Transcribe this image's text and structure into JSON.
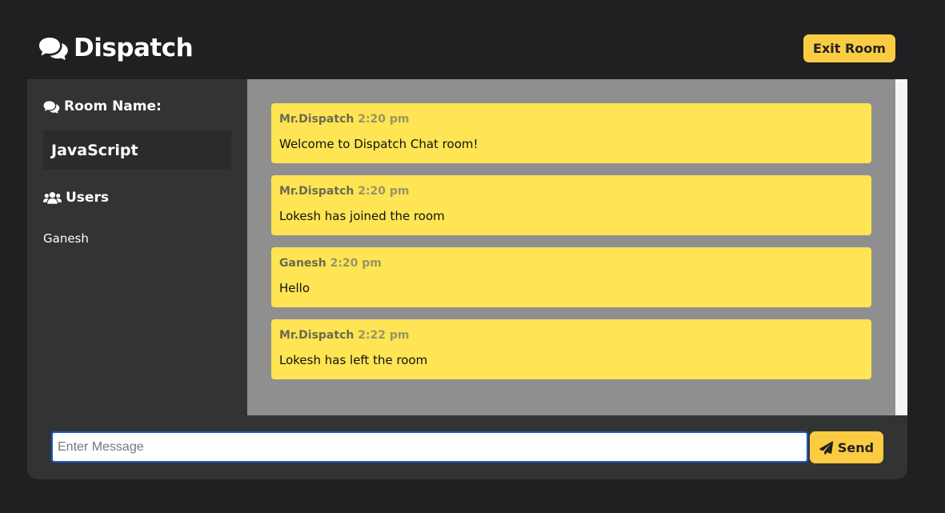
{
  "header": {
    "logo_icon": "comments-icon",
    "app_title": "Dispatch",
    "exit_label": "Exit Room"
  },
  "sidebar": {
    "room_heading": "Room Name:",
    "room_name": "JavaScript",
    "users_heading": "Users",
    "users": [
      "Ganesh"
    ]
  },
  "messages": [
    {
      "user": "Mr.Dispatch",
      "time": "2:20 pm",
      "text": "Welcome to Dispatch Chat room!"
    },
    {
      "user": "Mr.Dispatch",
      "time": "2:20 pm",
      "text": "Lokesh has joined the room"
    },
    {
      "user": "Ganesh",
      "time": "2:20 pm",
      "text": "Hello"
    },
    {
      "user": "Mr.Dispatch",
      "time": "2:22 pm",
      "text": "Lokesh has left the room"
    }
  ],
  "composer": {
    "placeholder": "Enter Message",
    "value": "",
    "send_label": "Send",
    "send_icon": "paper-plane-icon"
  },
  "colors": {
    "accent": "#fbcc42",
    "message_bg": "#ffe553",
    "chat_bg": "#8f8f8f",
    "sidebar_bg": "#313432",
    "header_bg": "#201f21"
  }
}
